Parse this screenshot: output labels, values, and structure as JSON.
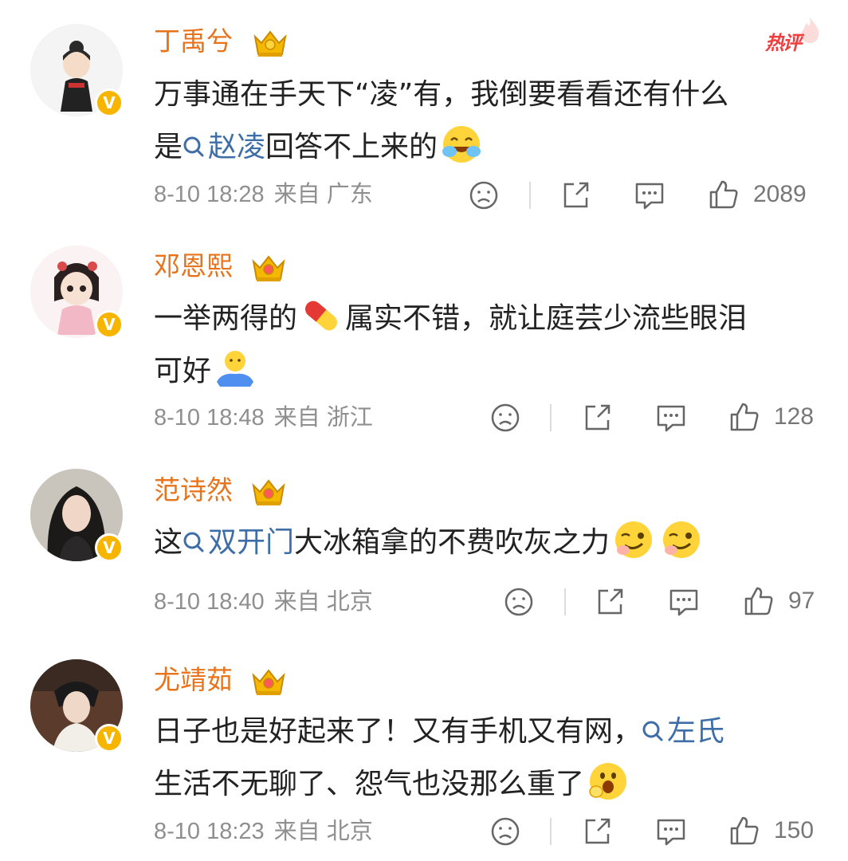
{
  "hot_label": "热评",
  "comments": [
    {
      "username": "丁禹兮",
      "text_parts": [
        "万事通在手天下“凌”有，我倒要看看还有什么",
        "是",
        "赵凌",
        "回答不上来的"
      ],
      "emoji": "laugh-cry-emoji",
      "date": "8-10 18:28",
      "source_prefix": "来自",
      "location": "广东",
      "likes": "2089"
    },
    {
      "username": "邓恩熙",
      "text_parts": [
        "一举两得的",
        "属实不错，就让庭芸少流些眼泪",
        "可好"
      ],
      "emoji": "pill-emoji",
      "emoji2": "shrug-emoji",
      "date": "8-10 18:48",
      "source_prefix": "来自",
      "location": "浙江",
      "likes": "128"
    },
    {
      "username": "范诗然",
      "text_parts": [
        "这",
        "双开门",
        "大冰箱拿的不费吹灰之力"
      ],
      "emoji": "doge-emoji",
      "date": "8-10 18:40",
      "source_prefix": "来自",
      "location": "北京",
      "likes": "97"
    },
    {
      "username": "尤靖茹",
      "text_parts": [
        "日子也是好起来了！又有手机又有网，",
        "左氏",
        "生活不无聊了、怨气也没那么重了"
      ],
      "emoji": "giggle-emoji",
      "date": "8-10 18:23",
      "source_prefix": "来自",
      "location": "北京",
      "likes": "150"
    }
  ],
  "colors": {
    "username": "#e8731a",
    "topic_link": "#3e6ea7",
    "meta": "#8f8f8f",
    "verified_badge": "#f7b500",
    "hot": "#f03e3e"
  }
}
